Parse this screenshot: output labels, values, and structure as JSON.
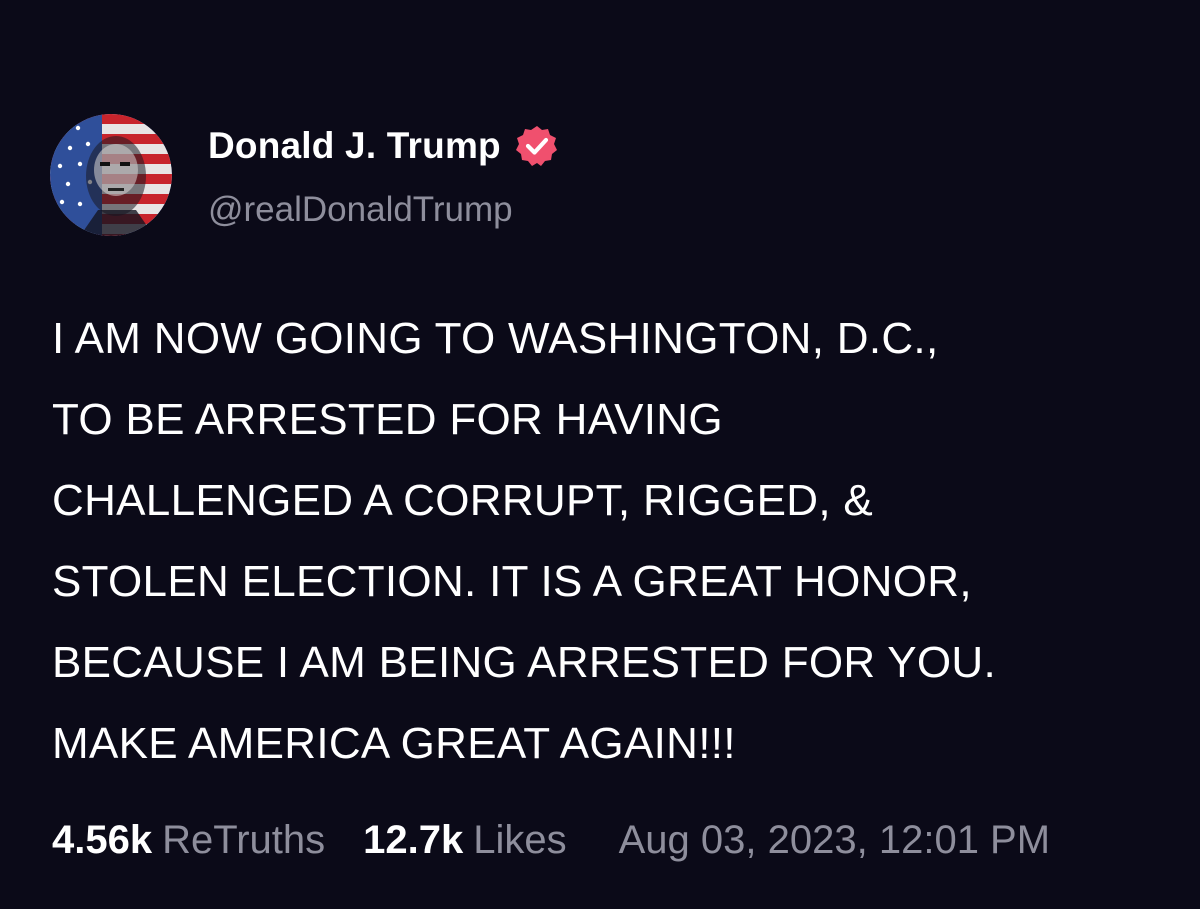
{
  "post": {
    "author": {
      "display_name": "Donald J. Trump",
      "handle": "@realDonaldTrump",
      "verified_icon": "verified-badge-icon",
      "avatar": "profile-photo",
      "badge_color": "#f0506e"
    },
    "body_lines": [
      "I AM NOW GOING TO WASHINGTON, D.C.,",
      "TO BE ARRESTED FOR HAVING",
      "CHALLENGED A CORRUPT, RIGGED, &",
      "STOLEN ELECTION. IT IS A GREAT HONOR,",
      "BECAUSE I AM BEING ARRESTED FOR YOU.",
      "MAKE AMERICA GREAT AGAIN!!!"
    ],
    "stats": {
      "retruths_count": "4.56k",
      "retruths_label": "ReTruths",
      "likes_count": "12.7k",
      "likes_label": "Likes"
    },
    "timestamp": "Aug 03, 2023, 12:01 PM"
  },
  "colors": {
    "background": "#0b0a18",
    "text_primary": "#ffffff",
    "text_secondary": "#8e8e9c"
  }
}
